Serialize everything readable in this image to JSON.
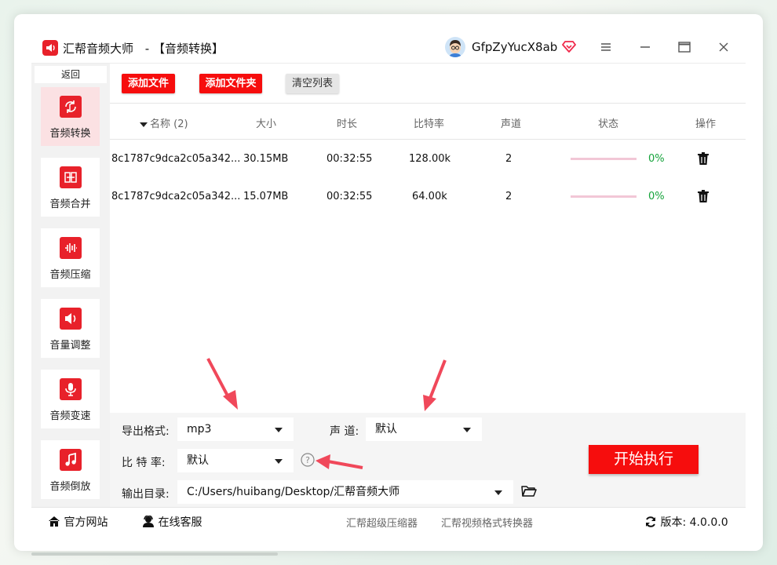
{
  "app": {
    "name": "汇帮音频大师",
    "module_title": "-  【音频转换】",
    "username": "GfpZyYucX8ab"
  },
  "sidebar": {
    "back_label": "返回",
    "items": [
      {
        "label": "音频转换",
        "icon": "audio-convert-icon",
        "active": true
      },
      {
        "label": "音频合并",
        "icon": "audio-merge-icon",
        "active": false
      },
      {
        "label": "音频压缩",
        "icon": "audio-compress-icon",
        "active": false
      },
      {
        "label": "音量调整",
        "icon": "volume-icon",
        "active": false
      },
      {
        "label": "音频变速",
        "icon": "microphone-icon",
        "active": false
      },
      {
        "label": "音频倒放",
        "icon": "music-note-icon",
        "active": false
      }
    ]
  },
  "toolbar": {
    "add_file": "添加文件",
    "add_folder": "添加文件夹",
    "clear_list": "清空列表"
  },
  "table": {
    "headers": {
      "name": "名称 (2)",
      "size": "大小",
      "duration": "时长",
      "bitrate": "比特率",
      "channels": "声道",
      "status": "状态",
      "action": "操作"
    },
    "rows": [
      {
        "name": "8c1787c9dca2c05a342...",
        "size": "30.15MB",
        "duration": "00:32:55",
        "bitrate": "128.00k",
        "channels": "2",
        "progress": "0%"
      },
      {
        "name": "8c1787c9dca2c05a342...",
        "size": "15.07MB",
        "duration": "00:32:55",
        "bitrate": "64.00k",
        "channels": "2",
        "progress": "0%"
      }
    ]
  },
  "settings": {
    "format_label": "导出格式:",
    "format_value": "mp3",
    "channel_label": "声 道:",
    "channel_value": "默认",
    "bitrate_label": "比 特 率:",
    "bitrate_value": "默认",
    "output_label": "输出目录:",
    "output_value": "C:/Users/huibang/Desktop/汇帮音频大师",
    "start_button": "开始执行"
  },
  "footer": {
    "website": "官方网站",
    "support": "在线客服",
    "link1": "汇帮超级压缩器",
    "link2": "汇帮视频格式转换器",
    "version": "版本:  4.0.0.0"
  },
  "colors": {
    "accent": "#f60d0d",
    "progress_text": "#15a33b",
    "arrow": "#f0485a"
  }
}
